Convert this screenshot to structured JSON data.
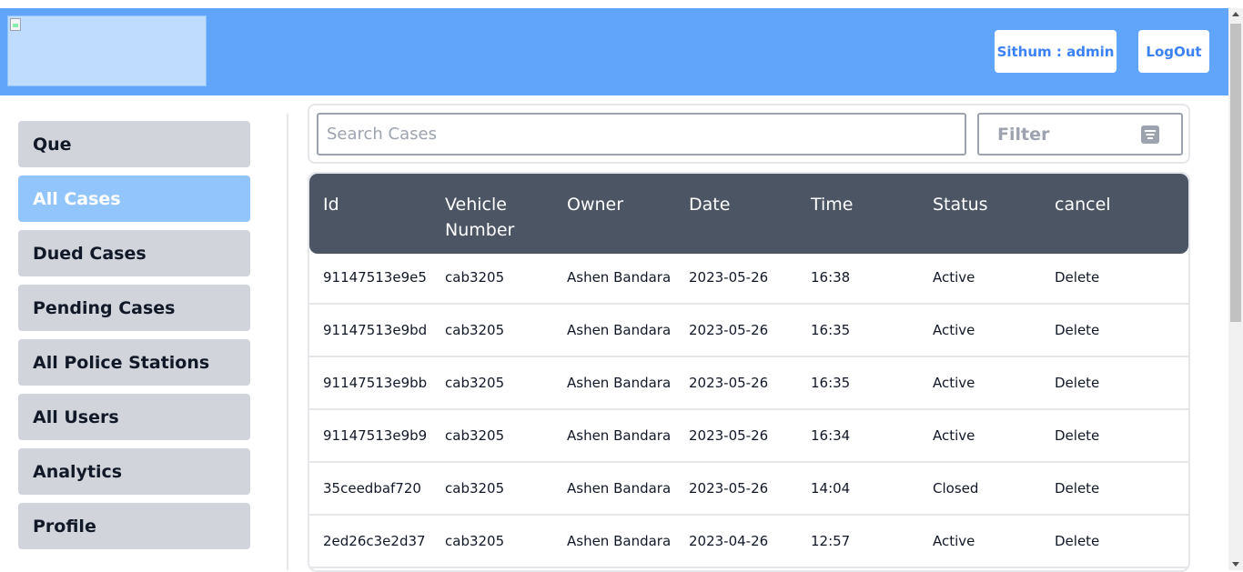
{
  "header": {
    "user_label": "Sithum : admin",
    "logout_label": "LogOut",
    "logo_icon": "broken-image-icon"
  },
  "sidebar": {
    "items": [
      {
        "label": "Que",
        "active": false
      },
      {
        "label": "All Cases",
        "active": true
      },
      {
        "label": "Dued Cases",
        "active": false
      },
      {
        "label": "Pending Cases",
        "active": false
      },
      {
        "label": "All Police Stations",
        "active": false
      },
      {
        "label": "All Users",
        "active": false
      },
      {
        "label": "Analytics",
        "active": false
      },
      {
        "label": "Profile",
        "active": false
      }
    ]
  },
  "search": {
    "placeholder": "Search Cases",
    "value": "",
    "filter_label": "Filter",
    "filter_icon": "filter-list-icon"
  },
  "table": {
    "columns": [
      "Id",
      "Vehicle\nNumber",
      "Owner",
      "Date",
      "Time",
      "Status",
      "cancel"
    ],
    "rows": [
      [
        "91147513e9e5",
        "cab3205",
        "Ashen Bandara",
        "2023-05-26",
        "16:38",
        "Active",
        "Delete"
      ],
      [
        "91147513e9bd",
        "cab3205",
        "Ashen Bandara",
        "2023-05-26",
        "16:35",
        "Active",
        "Delete"
      ],
      [
        "91147513e9bb",
        "cab3205",
        "Ashen Bandara",
        "2023-05-26",
        "16:35",
        "Active",
        "Delete"
      ],
      [
        "91147513e9b9",
        "cab3205",
        "Ashen Bandara",
        "2023-05-26",
        "16:34",
        "Active",
        "Delete"
      ],
      [
        "35ceedbaf720",
        "cab3205",
        "Ashen Bandara",
        "2023-05-26",
        "14:04",
        "Closed",
        "Delete"
      ],
      [
        "2ed26c3e2d37",
        "cab3205",
        "Ashen Bandara",
        "2023-04-26",
        "12:57",
        "Active",
        "Delete"
      ]
    ]
  },
  "colors": {
    "header_bg": "#60a5fa",
    "accent_text": "#3b82f6",
    "nav_active": "#93c5fd",
    "nav_default": "#d1d5db",
    "table_header": "#4b5563"
  }
}
